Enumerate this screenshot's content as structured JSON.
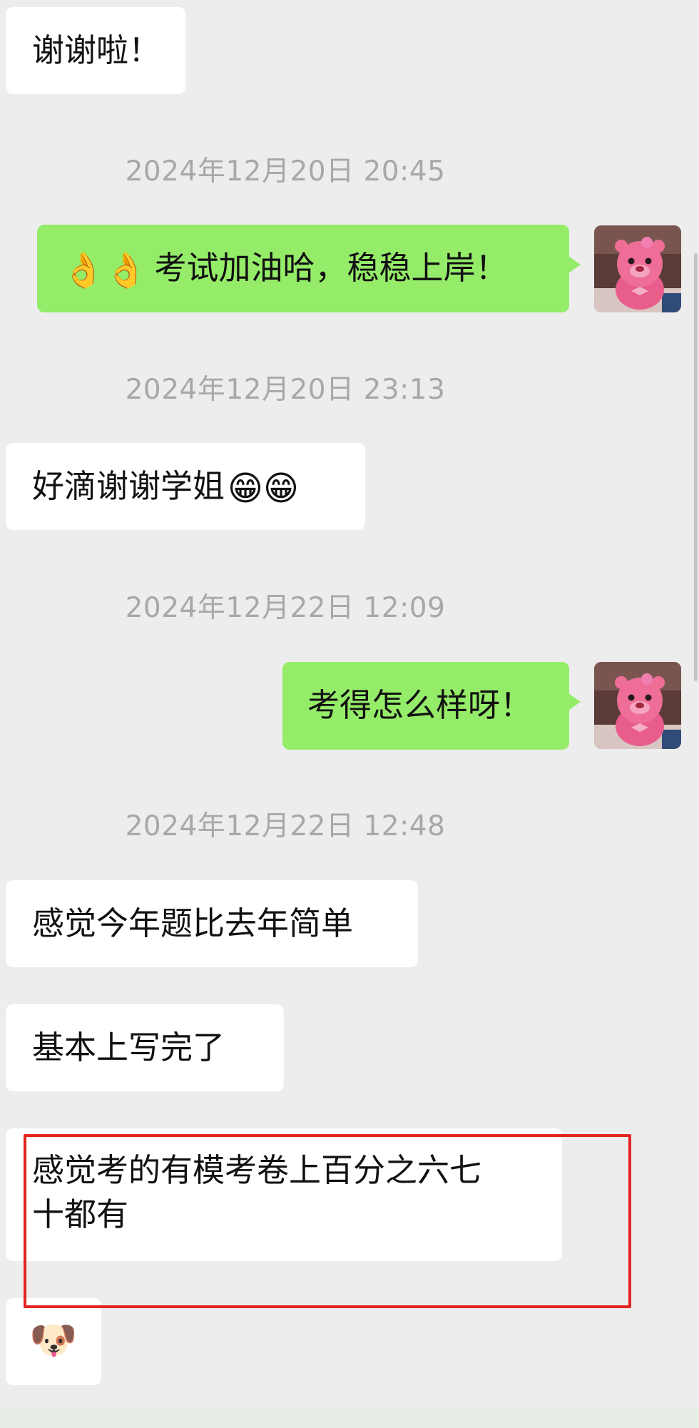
{
  "messages": {
    "m1": {
      "text": "谢谢啦！"
    },
    "t1": "2024年12月20日 20:45",
    "m2": {
      "emoji": "👌👌",
      "text": "考试加油哈，稳稳上岸！"
    },
    "t2": "2024年12月20日 23:13",
    "m3": {
      "text": "好滴谢谢学姐",
      "emoji": "😁😁"
    },
    "t3": "2024年12月22日 12:09",
    "m4": {
      "text": "考得怎么样呀！"
    },
    "t4": "2024年12月22日 12:48",
    "m5": {
      "text": "感觉今年题比去年简单"
    },
    "m6": {
      "text": "基本上写完了"
    },
    "m7": {
      "line1": "感觉考的有模考卷上百分之六七",
      "line2": "十都有"
    },
    "m8": {
      "emoji": "🐶"
    }
  },
  "avatar_icon": "pink-beaver-avatar-icon",
  "colors": {
    "background": "#ededed",
    "incoming_bubble": "#ffffff",
    "outgoing_bubble": "#95ec69",
    "timestamp_text": "#a8a8a8",
    "highlight_box": "#e32420"
  }
}
